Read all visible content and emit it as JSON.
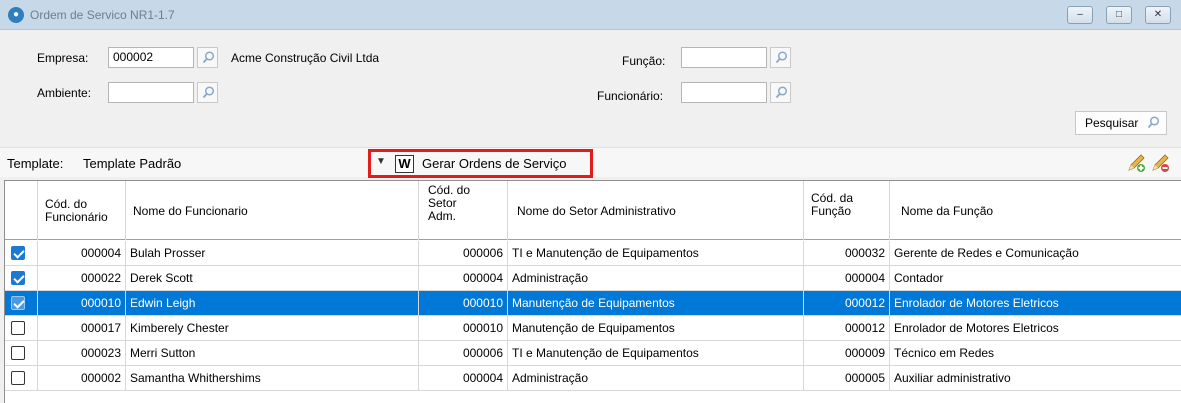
{
  "window": {
    "title": "Ordem de Servico NR1-1.7",
    "min_glyph": "–",
    "max_glyph": "□",
    "close_glyph": "✕"
  },
  "filters": {
    "empresa_label": "Empresa:",
    "empresa_code": "000002",
    "empresa_name": "Acme Construção Civil Ltda",
    "ambiente_label": "Ambiente:",
    "ambiente_value": "",
    "funcao_label": "Função:",
    "funcao_value": "",
    "funcionario_label": "Funcionário:",
    "funcionario_value": "",
    "search_button": "Pesquisar"
  },
  "toolbar": {
    "template_label": "Template:",
    "template_value": "Template Padrão",
    "gerar_icon_glyph": "W",
    "gerar_label": "Gerar Ordens de Serviço"
  },
  "table": {
    "headers": {
      "cod_func": [
        "Cód. do",
        "Funcionário"
      ],
      "nome_func": "Nome do Funcionario",
      "cod_setor": [
        "Cód. do",
        "Setor",
        "Adm."
      ],
      "nome_setor": "Nome do Setor Administrativo",
      "cod_funcao": [
        "Cód. da",
        "Função"
      ],
      "nome_funcao": "Nome da Função"
    },
    "rows": [
      {
        "checked": true,
        "selected": false,
        "cod_func": "000004",
        "nome_func": "Bulah Prosser",
        "cod_setor": "000006",
        "nome_setor": "TI e Manutenção de Equipamentos",
        "cod_funcao": "000032",
        "nome_funcao": "Gerente de Redes e Comunicação"
      },
      {
        "checked": true,
        "selected": false,
        "cod_func": "000022",
        "nome_func": "Derek Scott",
        "cod_setor": "000004",
        "nome_setor": "Administração",
        "cod_funcao": "000004",
        "nome_funcao": "Contador"
      },
      {
        "checked": true,
        "selected": true,
        "cod_func": "000010",
        "nome_func": "Edwin Leigh",
        "cod_setor": "000010",
        "nome_setor": "Manutenção de Equipamentos",
        "cod_funcao": "000012",
        "nome_funcao": "Enrolador de Motores Eletricos"
      },
      {
        "checked": false,
        "selected": false,
        "cod_func": "000017",
        "nome_func": "Kimberely Chester",
        "cod_setor": "000010",
        "nome_setor": "Manutenção de Equipamentos",
        "cod_funcao": "000012",
        "nome_funcao": "Enrolador de Motores Eletricos"
      },
      {
        "checked": false,
        "selected": false,
        "cod_func": "000023",
        "nome_func": "Merri Sutton",
        "cod_setor": "000006",
        "nome_setor": "TI e Manutenção de Equipamentos",
        "cod_funcao": "000009",
        "nome_funcao": "Técnico em Redes"
      },
      {
        "checked": false,
        "selected": false,
        "cod_func": "000002",
        "nome_func": "Samantha Whithershims",
        "cod_setor": "000004",
        "nome_setor": "Administração",
        "cod_funcao": "000005",
        "nome_funcao": "Auxiliar administrativo"
      }
    ]
  },
  "colors": {
    "selected_row": "#0078d7",
    "highlight_border": "#e21b1b",
    "titlebar": "#c7d9e8"
  }
}
